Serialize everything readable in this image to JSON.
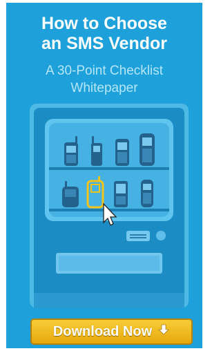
{
  "ad": {
    "title_line1": "How to Choose",
    "title_line2": "an SMS Vendor",
    "subtitle_line1": "A 30-Point Checklist",
    "subtitle_line2": "Whitepaper",
    "cta_label": "Download Now",
    "cta_icon": "down-arrow-icon",
    "colors": {
      "background": "#1ea1da",
      "machine_body": "#1b8cc2",
      "highlight_phone": "#f2c318",
      "cta": "#e6a80c"
    }
  }
}
